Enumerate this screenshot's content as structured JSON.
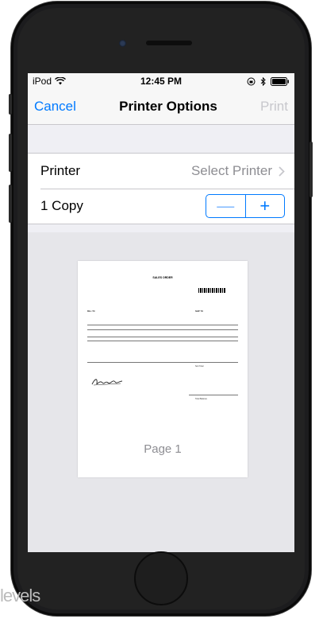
{
  "status": {
    "carrier": "iPod",
    "time": "12:45 PM"
  },
  "nav": {
    "cancel_label": "Cancel",
    "title": "Printer Options",
    "print_label": "Print"
  },
  "options": {
    "printer_label": "Printer",
    "printer_value": "Select Printer",
    "copies_label": "1 Copy",
    "minus_label": "—",
    "plus_label": "+"
  },
  "preview": {
    "page_label": "Page 1",
    "doc_title": "SALES ORDER",
    "bill_to": "BILL TO",
    "ship_to": "SHIP TO",
    "sub_total": "Sub Total",
    "total_balance": "Total Balance"
  },
  "watermark": "levels",
  "colors": {
    "accent": "#007aff",
    "disabled": "#c7c7cc",
    "secondary_text": "#8e8e93"
  }
}
